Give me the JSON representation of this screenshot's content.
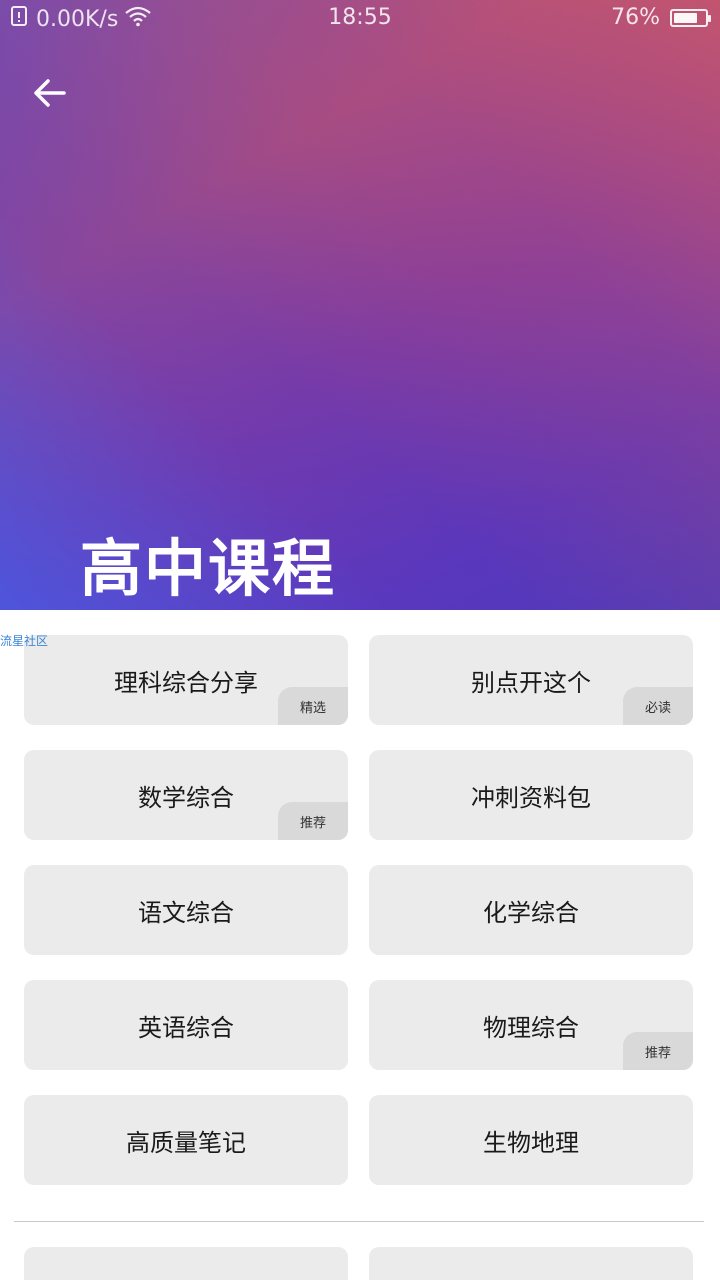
{
  "status_bar": {
    "network_speed": "0.00K/s",
    "time": "18:55",
    "battery_percent": "76%",
    "battery_level": 0.76
  },
  "header": {
    "title": "高中课程"
  },
  "watermark": "流星社区",
  "cards": [
    {
      "label": "理科综合分享",
      "badge": "精选"
    },
    {
      "label": "别点开这个",
      "badge": "必读"
    },
    {
      "label": "数学综合",
      "badge": "推荐"
    },
    {
      "label": "冲刺资料包",
      "badge": ""
    },
    {
      "label": "语文综合",
      "badge": ""
    },
    {
      "label": "化学综合",
      "badge": ""
    },
    {
      "label": "英语综合",
      "badge": ""
    },
    {
      "label": "物理综合",
      "badge": "推荐"
    },
    {
      "label": "高质量笔记",
      "badge": ""
    },
    {
      "label": "生物地理",
      "badge": ""
    }
  ],
  "icons": {
    "back": "arrow-left-icon",
    "sim": "sim-card-icon",
    "wifi": "wifi-icon",
    "battery": "battery-icon"
  }
}
